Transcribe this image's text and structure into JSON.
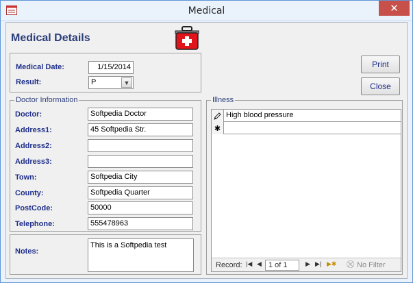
{
  "window": {
    "title": "Medical"
  },
  "form": {
    "heading": "Medical Details",
    "medical_date_label": "Medical Date:",
    "medical_date_value": "1/15/2014",
    "result_label": "Result:",
    "result_value": "P",
    "print_label": "Print",
    "close_label": "Close"
  },
  "doctor": {
    "legend": "Doctor Information",
    "fields": [
      {
        "label": "Doctor:",
        "value": "Softpedia Doctor"
      },
      {
        "label": "Address1:",
        "value": "45 Softpedia Str."
      },
      {
        "label": "Address2:",
        "value": ""
      },
      {
        "label": "Address3:",
        "value": ""
      },
      {
        "label": "Town:",
        "value": "Softpedia City"
      },
      {
        "label": "County:",
        "value": "Softpedia Quarter"
      },
      {
        "label": "PostCode:",
        "value": "50000"
      },
      {
        "label": "Telephone:",
        "value": "555478963"
      }
    ]
  },
  "notes": {
    "label": "Notes:",
    "value": "This is a Softpedia test"
  },
  "illness": {
    "legend": "Illness",
    "rows": [
      "High blood pressure",
      ""
    ],
    "record_label": "Record:",
    "record_value": "1 of 1",
    "no_filter_label": "No Filter"
  },
  "icons": {
    "app": "form-icon",
    "medkit": "first-aid-kit-icon",
    "combo": "chevron-down-icon",
    "edit": "pencil-icon",
    "new": "asterisk-icon",
    "filter": "filter-icon"
  },
  "colors": {
    "label": "#1f2f8a",
    "kit": "#e2141b",
    "close": "#c7504b"
  }
}
